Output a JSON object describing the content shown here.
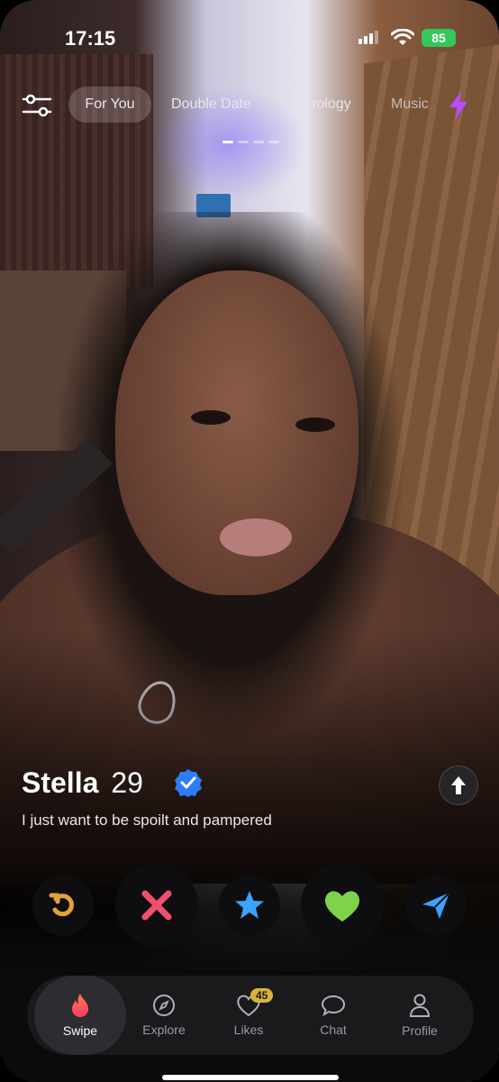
{
  "status_bar": {
    "time": "17:15",
    "battery": "85"
  },
  "top_nav": {
    "tabs": [
      {
        "label": "For You",
        "active": true
      },
      {
        "label": "Double Date"
      },
      {
        "label": "Astrology"
      },
      {
        "label": "Music"
      }
    ],
    "filter_icon": "sliders-icon",
    "boost_icon": "bolt-icon",
    "accent_color": "#b84dff"
  },
  "profile": {
    "name": "Stella",
    "age": "29",
    "verified": true,
    "bio": "I just want to be spoilt and pampered"
  },
  "actions": [
    {
      "name": "rewind",
      "icon": "rewind-icon",
      "color": "#e2a33b"
    },
    {
      "name": "nope",
      "icon": "close-icon",
      "color": "#f0506e"
    },
    {
      "name": "super-like",
      "icon": "star-icon",
      "color": "#3aa3ff"
    },
    {
      "name": "like",
      "icon": "heart-icon",
      "color": "#7fd34a"
    },
    {
      "name": "boost-send",
      "icon": "send-icon",
      "color": "#3aa3ff"
    }
  ],
  "bottom_nav": {
    "tabs": [
      {
        "label": "Swipe",
        "icon": "flame-icon",
        "active": true
      },
      {
        "label": "Explore",
        "icon": "compass-icon"
      },
      {
        "label": "Likes",
        "icon": "heart-outline-icon",
        "badge": "45"
      },
      {
        "label": "Chat",
        "icon": "chat-icon"
      },
      {
        "label": "Profile",
        "icon": "person-icon"
      }
    ]
  }
}
